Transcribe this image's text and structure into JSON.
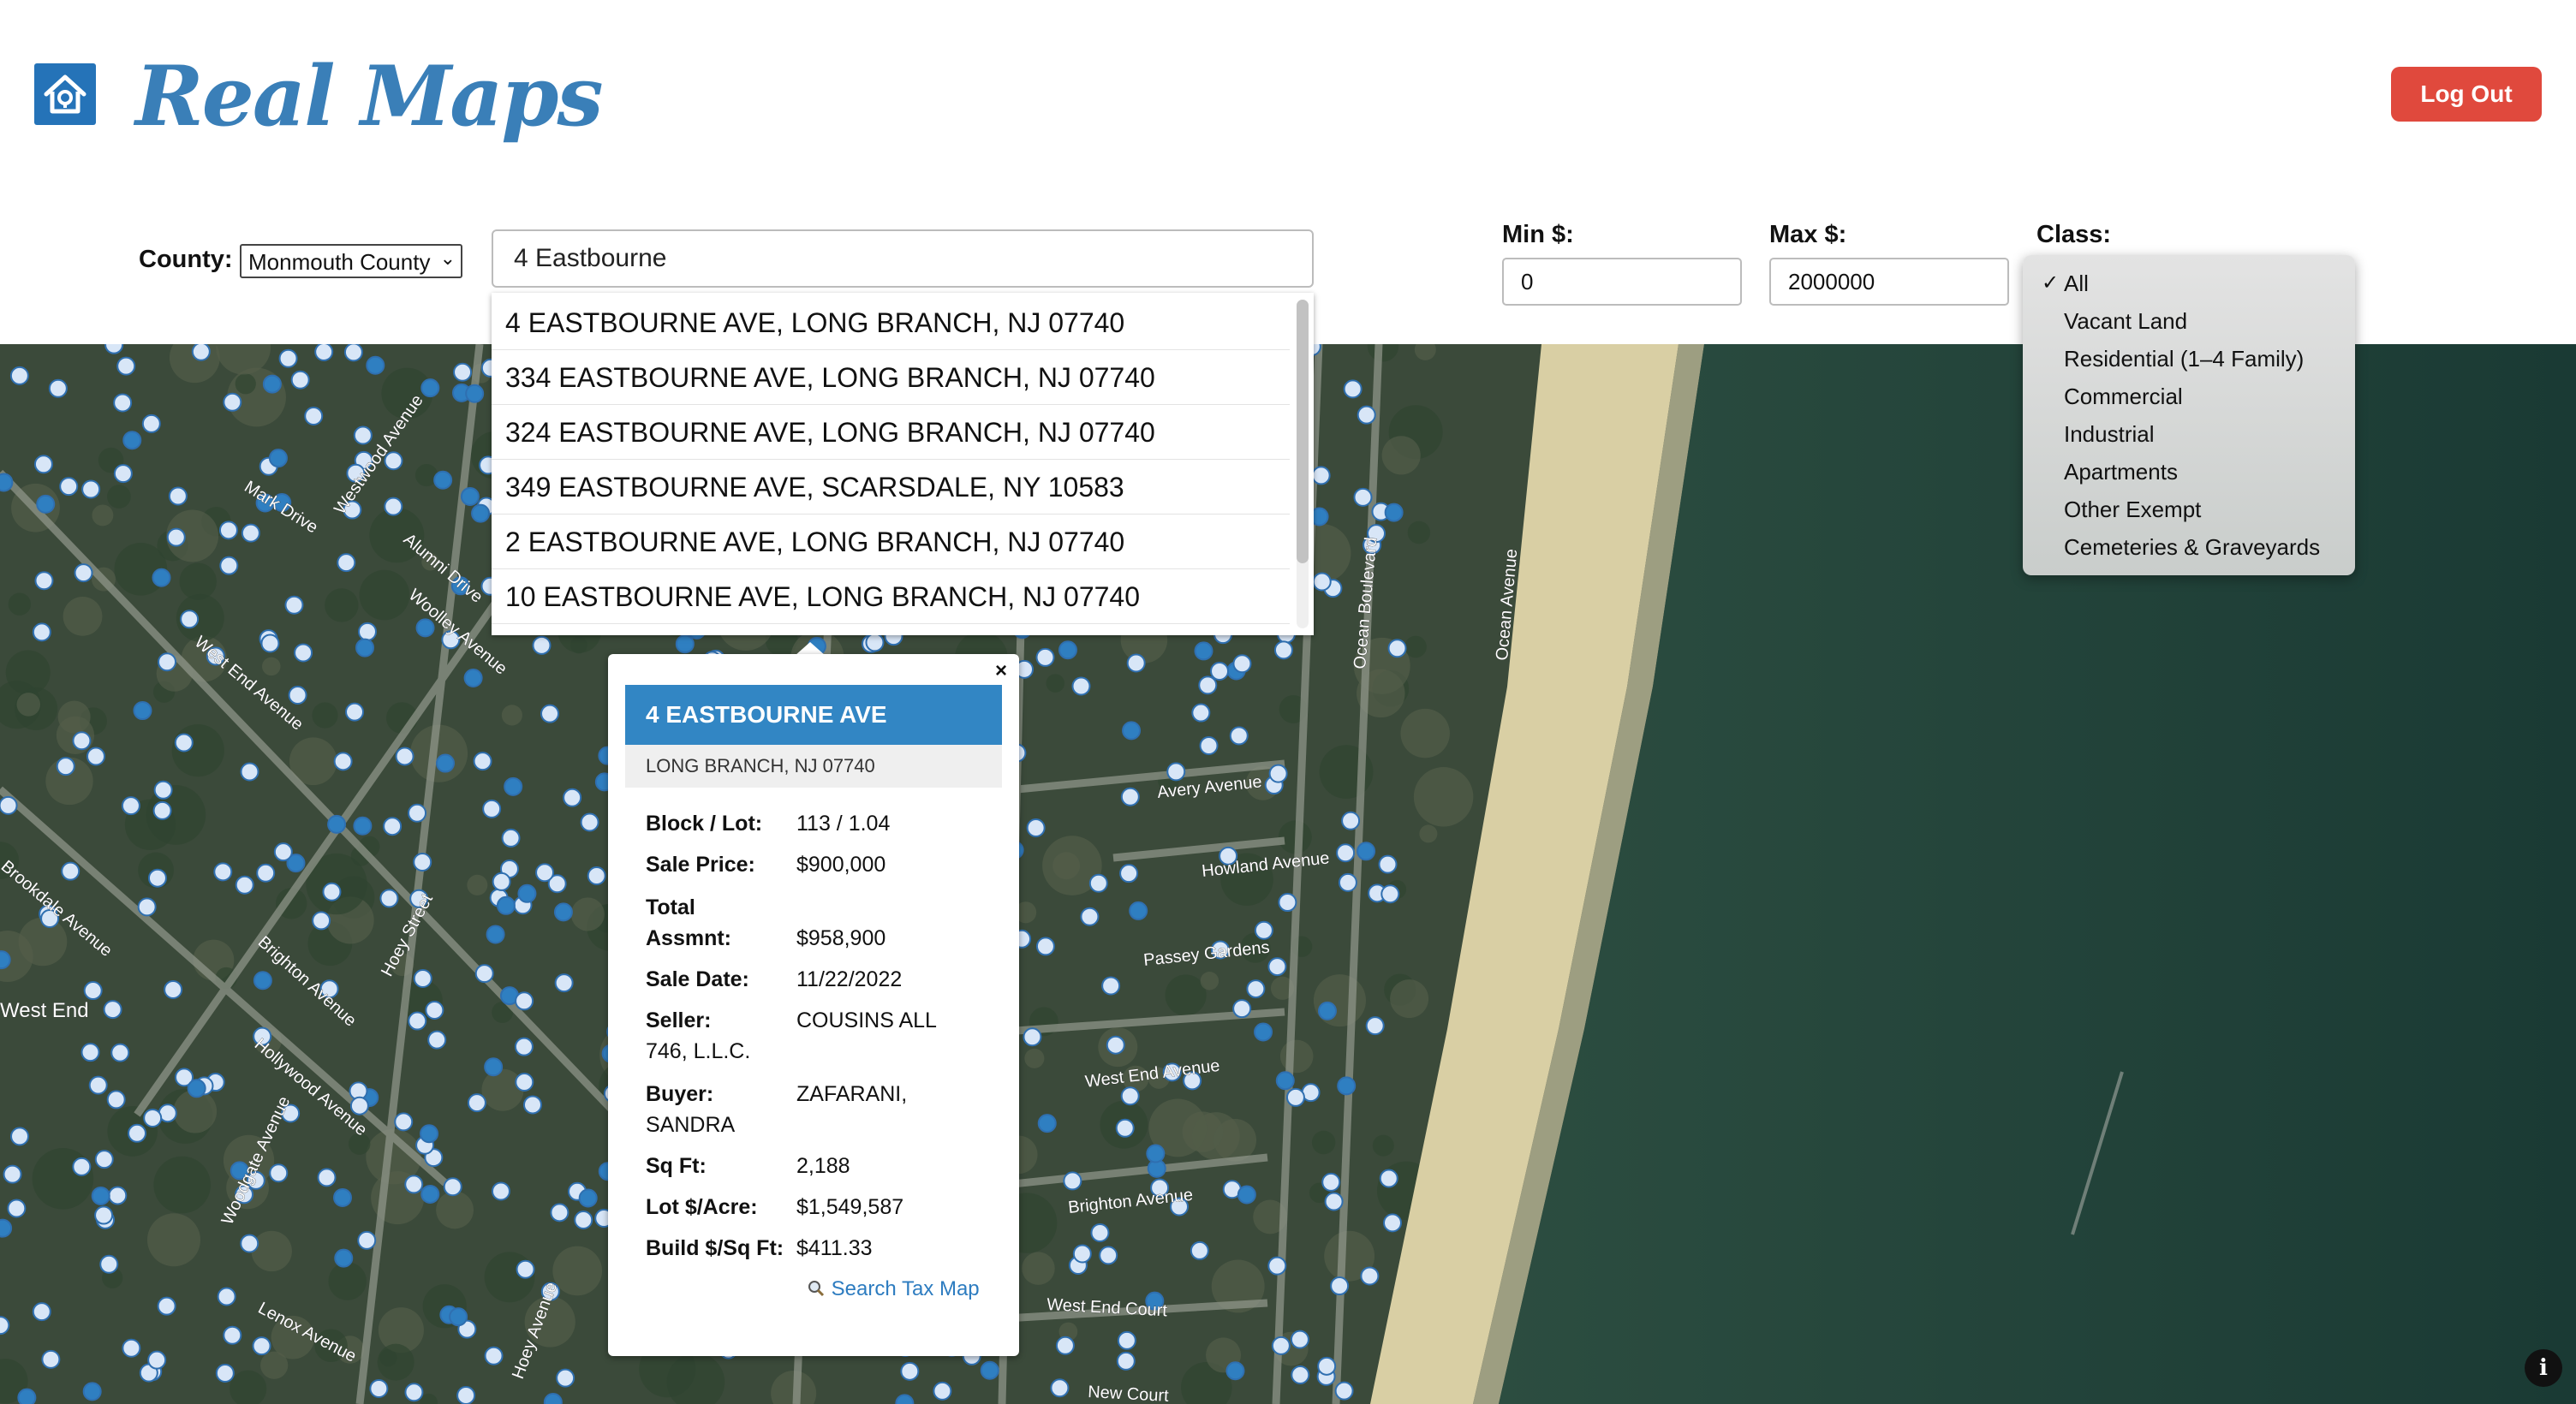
{
  "header": {
    "logo_text": "Real Maps",
    "logout_label": "Log Out"
  },
  "filters": {
    "county_label": "County:",
    "county_value": "Monmouth County",
    "search_value": "4 Eastbourne",
    "min_label": "Min $:",
    "min_value": "0",
    "max_label": "Max $:",
    "max_value": "2000000",
    "class_label": "Class:",
    "class_options": [
      "All",
      "Vacant Land",
      "Residential (1–4 Family)",
      "Commercial",
      "Industrial",
      "Apartments",
      "Other Exempt",
      "Cemeteries & Graveyards"
    ],
    "class_selected": "All"
  },
  "suggestions": [
    "4 EASTBOURNE AVE, LONG BRANCH, NJ 07740",
    "334 EASTBOURNE AVE, LONG BRANCH, NJ 07740",
    "324 EASTBOURNE AVE, LONG BRANCH, NJ 07740",
    "349 EASTBOURNE AVE, SCARSDALE, NY 10583",
    "2 EASTBOURNE AVE, LONG BRANCH, NJ 07740",
    "10 EASTBOURNE AVE, LONG BRANCH, NJ 07740"
  ],
  "map": {
    "street_labels": [
      "Mark Drive",
      "Westwood Avenue",
      "Alumni Drive",
      "Woolley Avenue",
      "West End Avenue",
      "Brighton Avenue",
      "Hoey Street",
      "Hollywood Avenue",
      "Woodgate Avenue",
      "Hoey Avenue",
      "Lenox Avenue",
      "Brookdale Avenue",
      "Avery Avenue",
      "Howland Avenue",
      "Passey Gardens",
      "West End Avenue",
      "Brighton Avenue",
      "West End Court",
      "New Court",
      "Ocean Boulevard",
      "Ocean Avenue",
      "West End"
    ],
    "colors": {
      "water": "#1f3d33",
      "beach": "#d9cfa4",
      "marker_light": "#d8e6f7",
      "marker_dark": "#2f7fc1"
    }
  },
  "popup": {
    "close_glyph": "×",
    "address": "4 EASTBOURNE AVE",
    "city_line": "LONG BRANCH, NJ 07740",
    "block_lot_label": "Block / Lot:",
    "block_lot": "113 / 1.04",
    "sale_price_label": "Sale Price:",
    "sale_price": "$900,000",
    "total_label_1": "Total",
    "total_label_2": "Assmnt:",
    "total_assmnt": "$958,900",
    "sale_date_label": "Sale Date:",
    "sale_date": "11/22/2022",
    "seller_label": "Seller:",
    "seller_1": "COUSINS ALL",
    "seller_2": "746, L.L.C.",
    "buyer_label": "Buyer:",
    "buyer_1": "ZAFARANI,",
    "buyer_2": "SANDRA",
    "sqft_label": "Sq Ft:",
    "sqft": "2,188",
    "lot_acre_label": "Lot $/Acre:",
    "lot_acre": "$1,549,587",
    "build_sqft_label": "Build $/Sq Ft:",
    "build_sqft": "$411.33",
    "tax_map_link": "Search Tax Map"
  },
  "icons": {
    "home": "home-pin-icon",
    "info": "info-icon",
    "search": "magnifier-icon",
    "check": "checkmark-icon"
  }
}
